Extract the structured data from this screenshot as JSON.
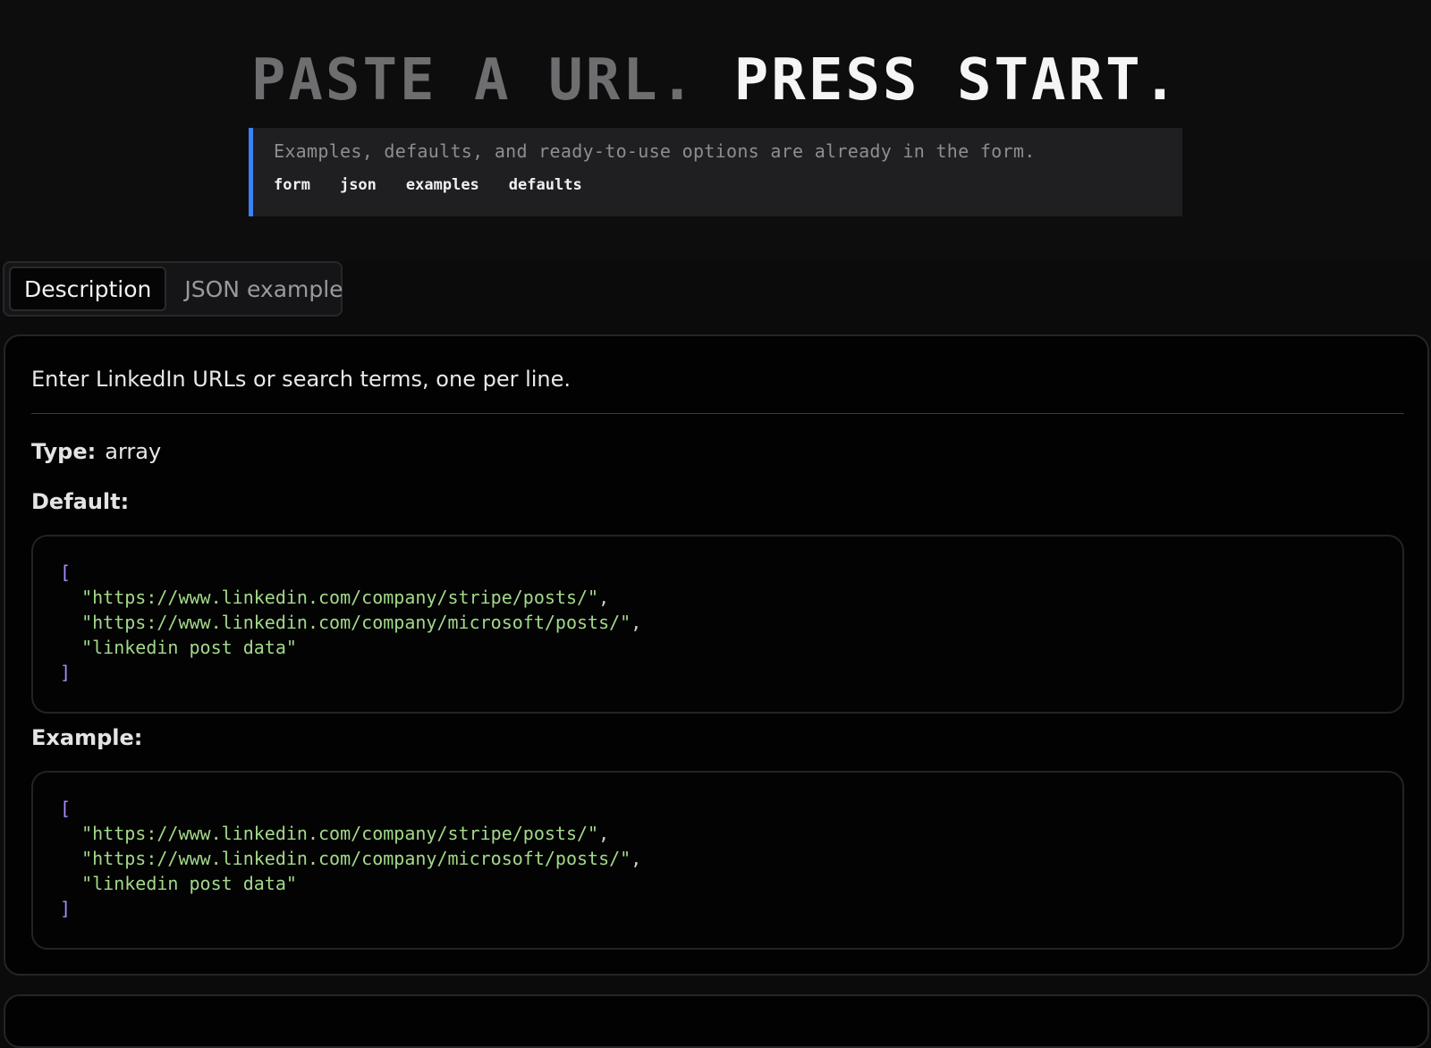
{
  "hero": {
    "title_dim": "PASTE A URL.",
    "title_bright": "PRESS START."
  },
  "notice": {
    "text": "Examples, defaults, and ready-to-use options are already in the form.",
    "tags": [
      "form",
      "json",
      "examples",
      "defaults"
    ],
    "accent_color": "#3b82f6"
  },
  "tabs": [
    {
      "label": "Description",
      "active": true
    },
    {
      "label": "JSON example",
      "active": false
    }
  ],
  "field": {
    "description": "Enter LinkedIn URLs or search terms, one per line.",
    "type_label": "Type:",
    "type_value": "array",
    "default_label": "Default:",
    "example_label": "Example:",
    "default_code": {
      "open": "[",
      "items": [
        "\"https://www.linkedin.com/company/stripe/posts/\"",
        "\"https://www.linkedin.com/company/microsoft/posts/\"",
        "\"linkedin post data\""
      ],
      "close": "]"
    },
    "example_code": {
      "open": "[",
      "items": [
        "\"https://www.linkedin.com/company/stripe/posts/\"",
        "\"https://www.linkedin.com/company/microsoft/posts/\"",
        "\"linkedin post data\""
      ],
      "close": "]"
    }
  },
  "colors": {
    "string": "#a3d98a",
    "bracket": "#a78bfa",
    "background": "#0b0b0c"
  }
}
